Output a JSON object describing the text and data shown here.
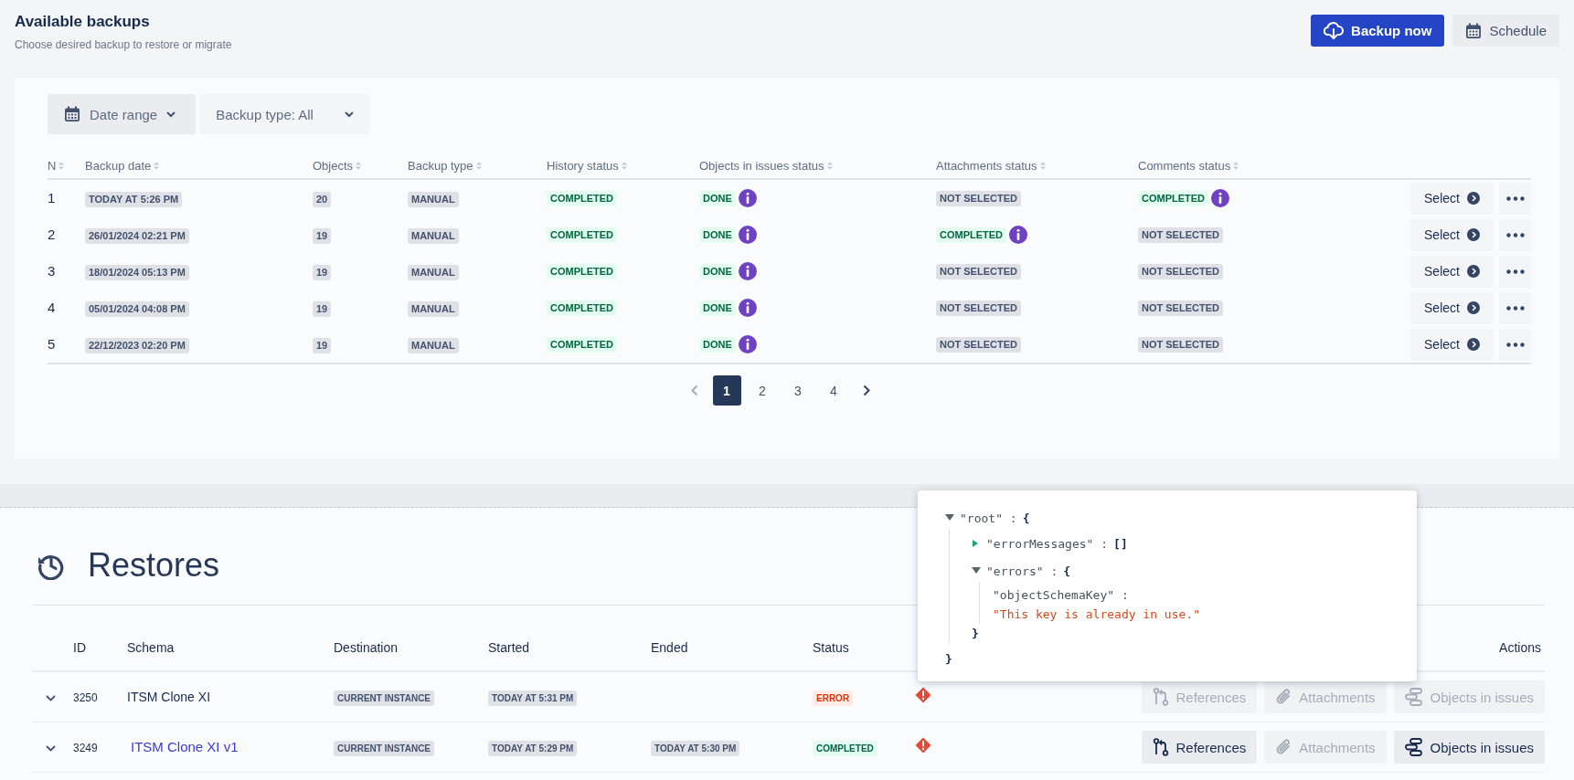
{
  "header": {
    "title": "Available backups",
    "subtitle": "Choose desired backup to restore or migrate",
    "buttons": [
      {
        "label": "Backup now",
        "kind": "primary"
      },
      {
        "label": "Schedule",
        "kind": "secondary"
      }
    ]
  },
  "filters": [
    {
      "label": "Date range",
      "kind": "date"
    },
    {
      "label": "Backup type: All",
      "kind": "plain"
    }
  ],
  "backups": {
    "columns": [
      "N",
      "Backup date",
      "Objects",
      "Backup type",
      "History status",
      "Objects in issues status",
      "Attachments status",
      "Comments status"
    ],
    "rows": [
      {
        "n": "1",
        "date": "TODAY AT 5:26 PM",
        "objects": "20",
        "type": "MANUAL",
        "action": "Select",
        "statuses": [
          {
            "text": "COMPLETED",
            "kind": "success",
            "info": false
          },
          {
            "text": "DONE",
            "kind": "success",
            "info": true
          },
          {
            "text": "NOT SELECTED",
            "kind": "neutral",
            "info": false
          },
          {
            "text": "COMPLETED",
            "kind": "success",
            "info": true
          }
        ]
      },
      {
        "n": "2",
        "date": "26/01/2024 02:21 PM",
        "objects": "19",
        "type": "MANUAL",
        "action": "Select",
        "statuses": [
          {
            "text": "COMPLETED",
            "kind": "success",
            "info": false
          },
          {
            "text": "DONE",
            "kind": "success",
            "info": true
          },
          {
            "text": "COMPLETED",
            "kind": "success",
            "info": true
          },
          {
            "text": "NOT SELECTED",
            "kind": "neutral",
            "info": false
          }
        ]
      },
      {
        "n": "3",
        "date": "18/01/2024 05:13 PM",
        "objects": "19",
        "type": "MANUAL",
        "action": "Select",
        "statuses": [
          {
            "text": "COMPLETED",
            "kind": "success",
            "info": false
          },
          {
            "text": "DONE",
            "kind": "success",
            "info": true
          },
          {
            "text": "NOT SELECTED",
            "kind": "neutral",
            "info": false
          },
          {
            "text": "NOT SELECTED",
            "kind": "neutral",
            "info": false
          }
        ]
      },
      {
        "n": "4",
        "date": "05/01/2024 04:08 PM",
        "objects": "19",
        "type": "MANUAL",
        "action": "Select",
        "statuses": [
          {
            "text": "COMPLETED",
            "kind": "success",
            "info": false
          },
          {
            "text": "DONE",
            "kind": "success",
            "info": true
          },
          {
            "text": "NOT SELECTED",
            "kind": "neutral",
            "info": false
          },
          {
            "text": "NOT SELECTED",
            "kind": "neutral",
            "info": false
          }
        ]
      },
      {
        "n": "5",
        "date": "22/12/2023 02:20 PM",
        "objects": "19",
        "type": "MANUAL",
        "action": "Select",
        "statuses": [
          {
            "text": "COMPLETED",
            "kind": "success",
            "info": false
          },
          {
            "text": "DONE",
            "kind": "success",
            "info": true
          },
          {
            "text": "NOT SELECTED",
            "kind": "neutral",
            "info": false
          },
          {
            "text": "NOT SELECTED",
            "kind": "neutral",
            "info": false
          }
        ]
      }
    ]
  },
  "pagination": {
    "prev_disabled": true,
    "pages": [
      {
        "label": "1",
        "selected": true
      },
      {
        "label": "2",
        "selected": false
      },
      {
        "label": "3",
        "selected": false
      },
      {
        "label": "4",
        "selected": false
      }
    ]
  },
  "restores": {
    "title": "Restores",
    "columns": [
      "ID",
      "Schema",
      "Destination",
      "Started",
      "Ended",
      "Status"
    ],
    "actions_heading": "Actions",
    "rows": [
      {
        "id": "3250",
        "schema": "ITSM Clone XI",
        "link": false,
        "destination": "CURRENT INSTANCE",
        "started": "TODAY AT 5:31 PM",
        "status": {
          "text": "ERROR",
          "kind": "error"
        },
        "actions": [
          {
            "label": "References",
            "kind": "references",
            "disabled": true
          },
          {
            "label": "Attachments",
            "kind": "attachments",
            "disabled": true
          },
          {
            "label": "Objects in issues",
            "kind": "objects",
            "disabled": true
          }
        ]
      },
      {
        "id": "3249",
        "schema": "ITSM Clone XI v1",
        "link": true,
        "destination": "CURRENT INSTANCE",
        "started": "TODAY AT 5:29 PM",
        "ended": "TODAY AT 5:30 PM",
        "status": {
          "text": "COMPLETED",
          "kind": "success"
        },
        "actions": [
          {
            "label": "References",
            "kind": "references",
            "disabled": false
          },
          {
            "label": "Attachments",
            "kind": "attachments",
            "disabled": true
          },
          {
            "label": "Objects in issues",
            "kind": "objects",
            "disabled": false
          }
        ]
      }
    ]
  },
  "popover": {
    "tree": {
      "label": "\"root\" :",
      "value": "{",
      "expanded": true,
      "close": "}",
      "children": [
        {
          "label": "\"errorMessages\" :",
          "value": "[]",
          "expanded": false
        },
        {
          "label": "\"errors\" :",
          "value": "{",
          "expanded": true,
          "close": "}",
          "children": [
            {
              "label": "\"objectSchemaKey\" :",
              "value": "\"This key is already in use.\"",
              "kind": "string"
            }
          ]
        }
      ]
    }
  }
}
